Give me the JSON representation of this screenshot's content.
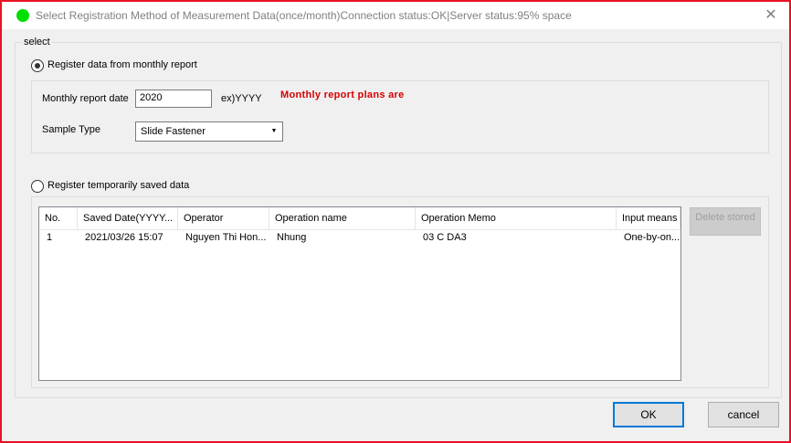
{
  "window": {
    "title": "Select Registration Method of Measurement Data(once/month)Connection status:OK|Server status:95% space",
    "status_color": "#00e000",
    "close_glyph": "✕"
  },
  "group": {
    "legend": "select"
  },
  "option_monthly": {
    "label": "Register data from monthly report",
    "checked": true,
    "date_label": "Monthly report date",
    "date_value": "2020",
    "date_hint": "ex)YYYY",
    "plans_text": "Monthly report plans are",
    "sample_label": "Sample Type",
    "sample_value": "Slide Fastener"
  },
  "option_temp": {
    "label": "Register temporarily saved data",
    "checked": false
  },
  "table": {
    "columns": [
      "No.",
      "Saved Date(YYYY...",
      "Operator",
      "Operation name",
      "Operation Memo",
      "Input means"
    ],
    "rows": [
      [
        "1",
        "2021/03/26 15:07",
        "Nguyen Thi Hon...",
        "Nhung",
        "03 C DA3",
        "One-by-on..."
      ]
    ]
  },
  "buttons": {
    "delete": "Delete stored",
    "ok": "OK",
    "cancel": "cancel"
  },
  "colors": {
    "accent": "#0078d7",
    "warning_text": "#d60000",
    "window_border": "#e81123"
  }
}
